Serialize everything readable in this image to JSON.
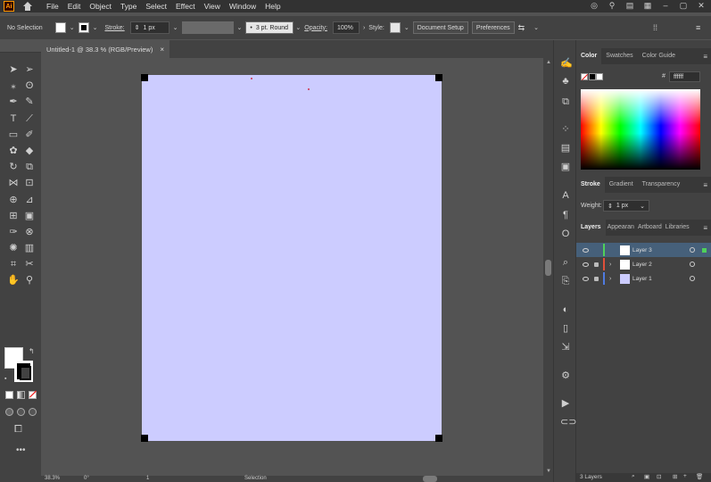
{
  "menubar": {
    "logo": "Ai",
    "items": [
      "File",
      "Edit",
      "Object",
      "Type",
      "Select",
      "Effect",
      "View",
      "Window",
      "Help"
    ]
  },
  "controlbar": {
    "selection_label": "No Selection",
    "stroke_label": "Stroke:",
    "stroke_weight": "1 px",
    "brush": "3 pt. Round",
    "opacity_label": "Opacity:",
    "opacity_value": "100%",
    "style_label": "Style:",
    "document_setup": "Document Setup",
    "preferences": "Preferences"
  },
  "document": {
    "tab_title": "Untitled-1 @ 38.3 % (RGB/Preview)",
    "tab_close": "×",
    "artboard_color": "#ccccff"
  },
  "statusbar": {
    "zoom": "38.3%",
    "rotation": "0°",
    "page": "1",
    "mode": "Selection"
  },
  "color_panel": {
    "tabs": [
      "Color",
      "Swatches",
      "Color Guide"
    ],
    "hex_symbol": "#",
    "hex_value": "ffffff"
  },
  "stroke_panel": {
    "tabs": [
      "Stroke",
      "Gradient",
      "Transparency"
    ],
    "weight_label": "Weight:",
    "weight_value": "1 px"
  },
  "layers_panel": {
    "tabs": [
      "Layers",
      "Appearan",
      "Artboard",
      "Libraries"
    ],
    "layers": [
      {
        "name": "Layer 3",
        "color": "#4fd05a",
        "selected": true
      },
      {
        "name": "Layer 2",
        "color": "#e0503a",
        "selected": false
      },
      {
        "name": "Layer 1",
        "color": "#4f7be0",
        "selected": false
      }
    ],
    "footer": "3 Layers"
  }
}
